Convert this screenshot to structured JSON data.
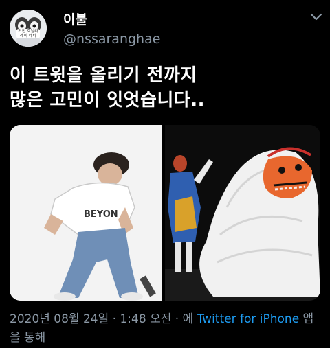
{
  "author": {
    "display_name": "이불",
    "handle": "@nssaranghae",
    "avatar_text": "거친 호날라 레이 네타"
  },
  "tweet": {
    "text_line1": "이 트윗을 올리기 전까지",
    "text_line2": "많은 고민이 잇엇습니다.."
  },
  "media": {
    "left_shirt_text": "BEYON"
  },
  "meta": {
    "date": "2020년 08월 24일",
    "sep1": " · ",
    "time": "1:48 오전",
    "sep2": " · ",
    "prefix": "에 ",
    "source": "Twitter for iPhone",
    "suffix": " 앱을 통해"
  },
  "colors": {
    "background": "#000000",
    "text": "#ffffff",
    "muted": "#8b98a5",
    "link": "#1d9bf0"
  },
  "icons": {
    "more": "chevron-down-icon"
  }
}
